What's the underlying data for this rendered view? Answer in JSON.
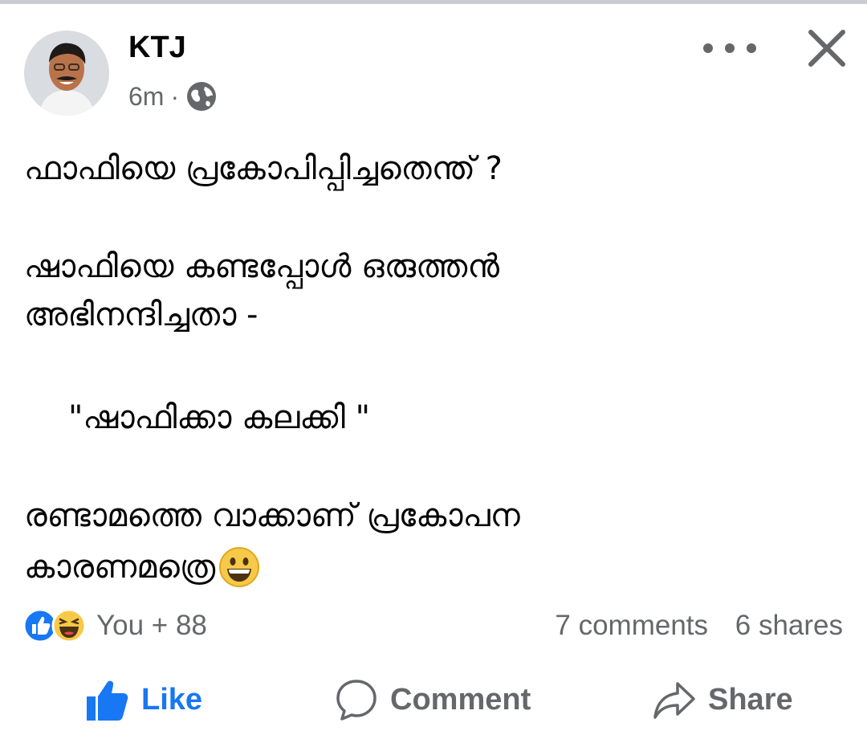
{
  "post": {
    "author": "KTJ",
    "time": "6m",
    "separator": "·",
    "audience_icon": "globe-icon",
    "lines": [
      "ഫാഫിയെ പ്രകോപിപ്പിച്ചതെന്ത് ?",
      "ഷാഫിയെ കണ്ടപ്പോൾ ഒരുത്തൻ",
      "അഭിനന്ദിച്ചതാ -",
      "\"ഷാഫിക്കാ കലക്കി \"",
      "രണ്ടാമത്തെ വാക്കാണ് പ്രകോപന",
      "കാരണമത്രെ"
    ],
    "trailing_emoji": "grinning-face-emoji"
  },
  "stats": {
    "reactions_text": "You + 88",
    "comments": "7 comments",
    "shares": "6 shares"
  },
  "actions": {
    "like": "Like",
    "comment": "Comment",
    "share": "Share"
  },
  "colors": {
    "like_blue": "#1877f2",
    "secondary_text": "#65676b",
    "emoji_yellow": "#f7c948"
  }
}
